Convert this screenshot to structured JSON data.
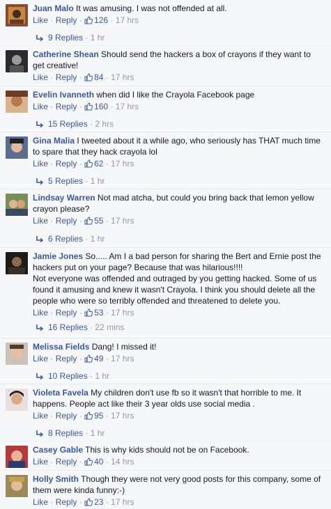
{
  "labels": {
    "like": "Like",
    "reply": "Reply",
    "sep": "·"
  },
  "comments": [
    {
      "name": "Juan Malo",
      "text": "It was amusing. I was not offended at all.",
      "likes": "126",
      "time": "17 hrs",
      "replies": "9 Replies",
      "replies_time": "1 hr"
    },
    {
      "name": "Catherine Shean",
      "text": "Should send the hackers a box of crayons if they want to get creative!",
      "likes": "84",
      "time": "17 hrs"
    },
    {
      "name": "Evelin Ivanneth",
      "text": "when did I like the Crayola Facebook page",
      "likes": "160",
      "time": "17 hrs",
      "replies": "15 Replies",
      "replies_time": "2 hrs"
    },
    {
      "name": "Gina Malia",
      "text": "I tweeted about it a while ago, who seriously has THAT much time to spare that they hack crayola lol",
      "likes": "62",
      "time": "17 hrs",
      "replies": "5 Replies",
      "replies_time": "1 hr"
    },
    {
      "name": "Lindsay Warren",
      "text": "Not mad atcha, but could you bring back that lemon yellow crayon please?",
      "likes": "55",
      "time": "17 hrs",
      "replies": "6 Replies",
      "replies_time": "1 hr"
    },
    {
      "name": "Jamie Jones",
      "text": "So..... Am I a bad person for sharing the Bert and Ernie post the hackers put on your page? Because that was hilarious!!!!\nNot everyone was offended and outraged by you getting hacked. Some of us found it amusing and knew it wasn't Crayola. I think you should delete all the people who were so terribly offended and threatened to delete you.",
      "likes": "53",
      "time": "17 hrs",
      "replies": "16 Replies",
      "replies_time": "22 mins"
    },
    {
      "name": "Melissa Fields",
      "text": "Dang! I missed it!",
      "likes": "49",
      "time": "17 hrs",
      "replies": "10 Replies",
      "replies_time": "1 hr"
    },
    {
      "name": "Violeta Favela",
      "text": "My children don't use fb so it wasn't that horrible to me. It happens. People act like their 3 year olds use social media .",
      "likes": "95",
      "time": "17 hrs",
      "replies": "8 Replies",
      "replies_time": "1 hr"
    },
    {
      "name": "Casey Gable",
      "text": "This is why kids should not be on Facebook.",
      "likes": "40",
      "time": "14 hrs"
    },
    {
      "name": "Holly Smith",
      "text": "Though they were not very good posts for this company, some of them were kinda funny:-)",
      "likes": "23",
      "time": "17 hrs"
    }
  ],
  "colors": {
    "link": "#3b5998",
    "meta": "#9197a3",
    "text": "#141823",
    "background": "#f6f7f9"
  }
}
